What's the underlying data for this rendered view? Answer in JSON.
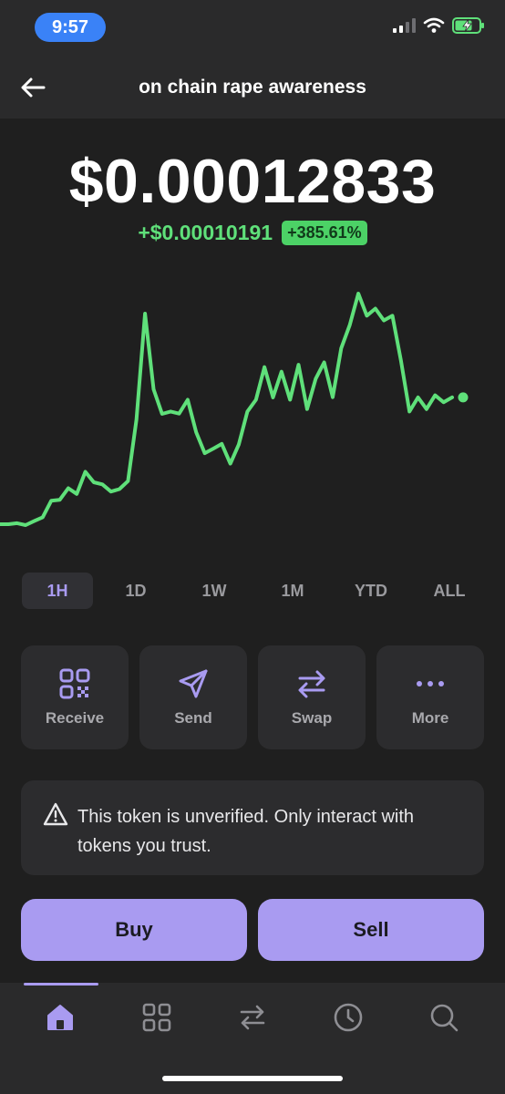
{
  "status_bar": {
    "time": "9:57"
  },
  "header": {
    "title": "on chain rape awareness"
  },
  "price": {
    "value": "$0.00012833",
    "change_abs": "+$0.00010191",
    "change_pct": "+385.61%"
  },
  "colors": {
    "accent": "#a99bf1",
    "positive": "#5fe07a",
    "background": "#1f1f1f",
    "card": "#2c2c2e"
  },
  "range_tabs": [
    {
      "label": "1H",
      "active": true
    },
    {
      "label": "1D"
    },
    {
      "label": "1W"
    },
    {
      "label": "1M"
    },
    {
      "label": "YTD"
    },
    {
      "label": "ALL"
    }
  ],
  "actions": [
    {
      "label": "Receive",
      "icon": "qr-code-icon"
    },
    {
      "label": "Send",
      "icon": "send-icon"
    },
    {
      "label": "Swap",
      "icon": "swap-icon"
    },
    {
      "label": "More",
      "icon": "more-icon"
    }
  ],
  "warning": {
    "text": "This token is unverified. Only interact with tokens you trust.",
    "icon": "warning-icon"
  },
  "trade": {
    "buy": "Buy",
    "sell": "Sell"
  },
  "tab_bar": {
    "items": [
      "home-icon",
      "grid-icon",
      "swap-icon",
      "history-icon",
      "search-icon"
    ],
    "active": 0
  },
  "chart_data": {
    "type": "line",
    "title": "",
    "xlabel": "",
    "ylabel": "",
    "grid": false,
    "values": [
      2.68e-05,
      2.68e-05,
      2.72e-05,
      2.64e-05,
      2.81e-05,
      2.97e-05,
      3.66e-05,
      3.7e-05,
      4.19e-05,
      3.95e-05,
      4.88e-05,
      4.44e-05,
      4.35e-05,
      4.05e-05,
      4.15e-05,
      4.49e-05,
      7.07e-05,
      0.0001152,
      8.34e-05,
      7.31e-05,
      7.41e-05,
      7.32e-05,
      7.9e-05,
      6.54e-05,
      5.66e-05,
      5.85e-05,
      6.05e-05,
      5.22e-05,
      6.03e-05,
      7.41e-05,
      7.9e-05,
      9.27e-05,
      8e-05,
      9.08e-05,
      7.9e-05,
      9.37e-05,
      7.51e-05,
      8.78e-05,
      9.47e-05,
      8.01e-05,
      0.0001006,
      0.0001104,
      0.0001236,
      0.0001143,
      0.0001173,
      0.0001123,
      0.0001143,
      9.56e-05,
      7.41e-05,
      8e-05,
      7.51e-05,
      8.09e-05,
      7.8e-05,
      8e-05
    ]
  }
}
